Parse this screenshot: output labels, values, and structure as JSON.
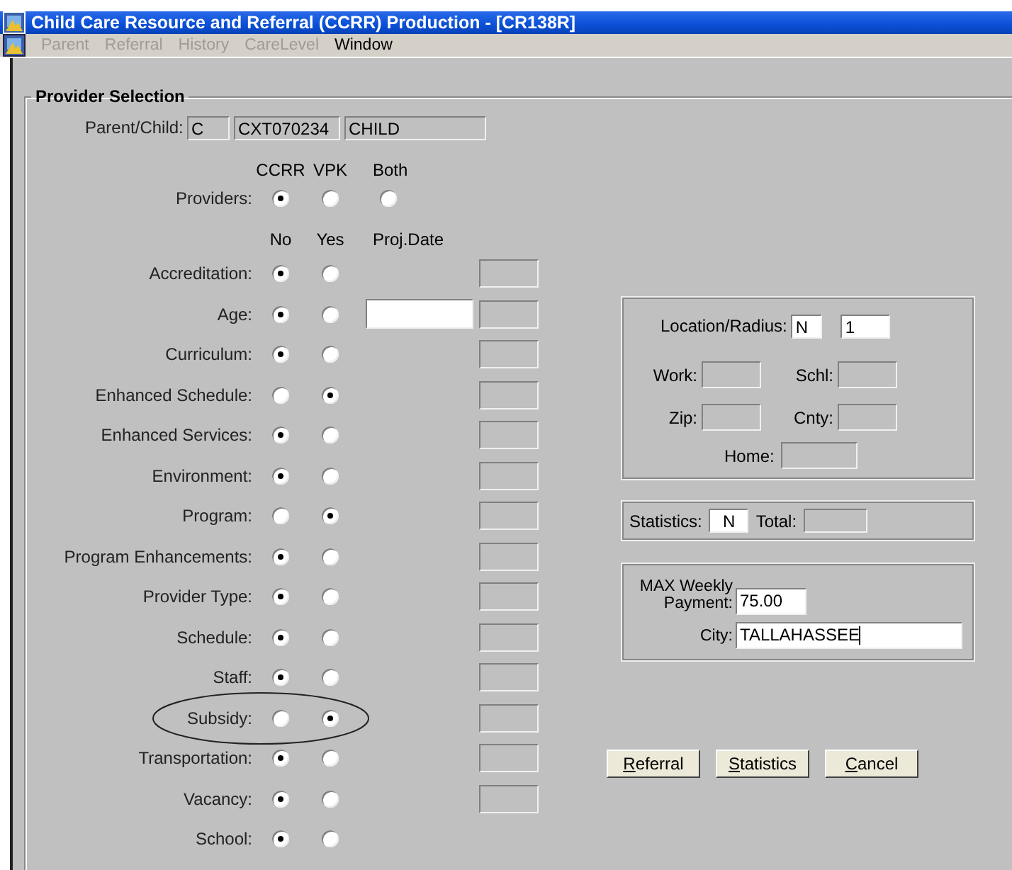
{
  "window": {
    "title": "Child Care Resource and Referral (CCRR) Production - [CR138R]"
  },
  "menu": [
    {
      "label": "Parent",
      "disabled": true
    },
    {
      "label": "Referral",
      "disabled": true
    },
    {
      "label": "History",
      "disabled": true
    },
    {
      "label": "CareLevel",
      "disabled": true
    },
    {
      "label": "Window",
      "disabled": false
    }
  ],
  "group": {
    "title": "Provider Selection"
  },
  "parent_child": {
    "label": "Parent/Child:",
    "values": [
      "C",
      "CXT070234",
      "CHILD"
    ]
  },
  "providers": {
    "label": "Providers:",
    "options": [
      {
        "label": "CCRR",
        "selected": true
      },
      {
        "label": "VPK",
        "selected": false
      },
      {
        "label": "Both",
        "selected": false
      }
    ]
  },
  "criteria": {
    "columns": [
      "No",
      "Yes",
      "Proj.Date"
    ],
    "rows": [
      {
        "label": "Accreditation:",
        "options": [
          {
            "selected": true
          },
          {
            "selected": false
          }
        ],
        "proj_date_field": false,
        "result_field": true,
        "circled": false
      },
      {
        "label": "Age:",
        "options": [
          {
            "selected": true
          },
          {
            "selected": false
          }
        ],
        "proj_date_field": true,
        "result_field": true,
        "circled": false
      },
      {
        "label": "Curriculum:",
        "options": [
          {
            "selected": true
          },
          {
            "selected": false
          }
        ],
        "proj_date_field": false,
        "result_field": true,
        "circled": false
      },
      {
        "label": "Enhanced Schedule:",
        "options": [
          {
            "selected": false
          },
          {
            "selected": true
          }
        ],
        "proj_date_field": false,
        "result_field": true,
        "circled": false
      },
      {
        "label": "Enhanced Services:",
        "options": [
          {
            "selected": true
          },
          {
            "selected": false
          }
        ],
        "proj_date_field": false,
        "result_field": true,
        "circled": false
      },
      {
        "label": "Environment:",
        "options": [
          {
            "selected": true
          },
          {
            "selected": false
          }
        ],
        "proj_date_field": false,
        "result_field": true,
        "circled": false
      },
      {
        "label": "Program:",
        "options": [
          {
            "selected": false
          },
          {
            "selected": true
          }
        ],
        "proj_date_field": false,
        "result_field": true,
        "circled": false
      },
      {
        "label": "Program Enhancements:",
        "options": [
          {
            "selected": true
          },
          {
            "selected": false
          }
        ],
        "proj_date_field": false,
        "result_field": true,
        "circled": false
      },
      {
        "label": "Provider Type:",
        "options": [
          {
            "selected": true
          },
          {
            "selected": false
          }
        ],
        "proj_date_field": false,
        "result_field": true,
        "circled": false
      },
      {
        "label": "Schedule:",
        "options": [
          {
            "selected": true
          },
          {
            "selected": false
          }
        ],
        "proj_date_field": false,
        "result_field": true,
        "circled": false
      },
      {
        "label": "Staff:",
        "options": [
          {
            "selected": true
          },
          {
            "selected": false
          }
        ],
        "proj_date_field": false,
        "result_field": true,
        "circled": false
      },
      {
        "label": "Subsidy:",
        "options": [
          {
            "selected": false
          },
          {
            "selected": true
          }
        ],
        "proj_date_field": false,
        "result_field": true,
        "circled": true
      },
      {
        "label": "Transportation:",
        "options": [
          {
            "selected": true
          },
          {
            "selected": false
          }
        ],
        "proj_date_field": false,
        "result_field": true,
        "circled": false
      },
      {
        "label": "Vacancy:",
        "options": [
          {
            "selected": true
          },
          {
            "selected": false
          }
        ],
        "proj_date_field": false,
        "result_field": true,
        "circled": false
      },
      {
        "label": "School:",
        "options": [
          {
            "selected": true
          },
          {
            "selected": false
          }
        ],
        "proj_date_field": false,
        "result_field": false,
        "circled": false
      }
    ]
  },
  "location": {
    "label": "Location/Radius:",
    "location": {
      "value": "N",
      "disabled": false
    },
    "radius": {
      "value": "1",
      "disabled": false
    },
    "fields": [
      {
        "label": "Work:",
        "disabled": true
      },
      {
        "label": "Schl:",
        "disabled": true
      },
      {
        "label": "Zip:",
        "disabled": true
      },
      {
        "label": "Cnty:",
        "disabled": true
      }
    ],
    "home": {
      "label": "Home:",
      "disabled": true
    }
  },
  "statistics": {
    "label": "Statistics:",
    "value": "N",
    "disabled": false,
    "total_label": "Total:",
    "total_disabled": true
  },
  "payment": {
    "label_lines": [
      "MAX Weekly",
      "Payment:"
    ],
    "value": "75.00",
    "city_label": "City:",
    "city": "TALLAHASSEE"
  },
  "buttons": [
    {
      "mnemonic": "R",
      "rest": "eferral"
    },
    {
      "mnemonic": "S",
      "rest": "tatistics"
    },
    {
      "mnemonic": "C",
      "rest": "ancel"
    }
  ]
}
